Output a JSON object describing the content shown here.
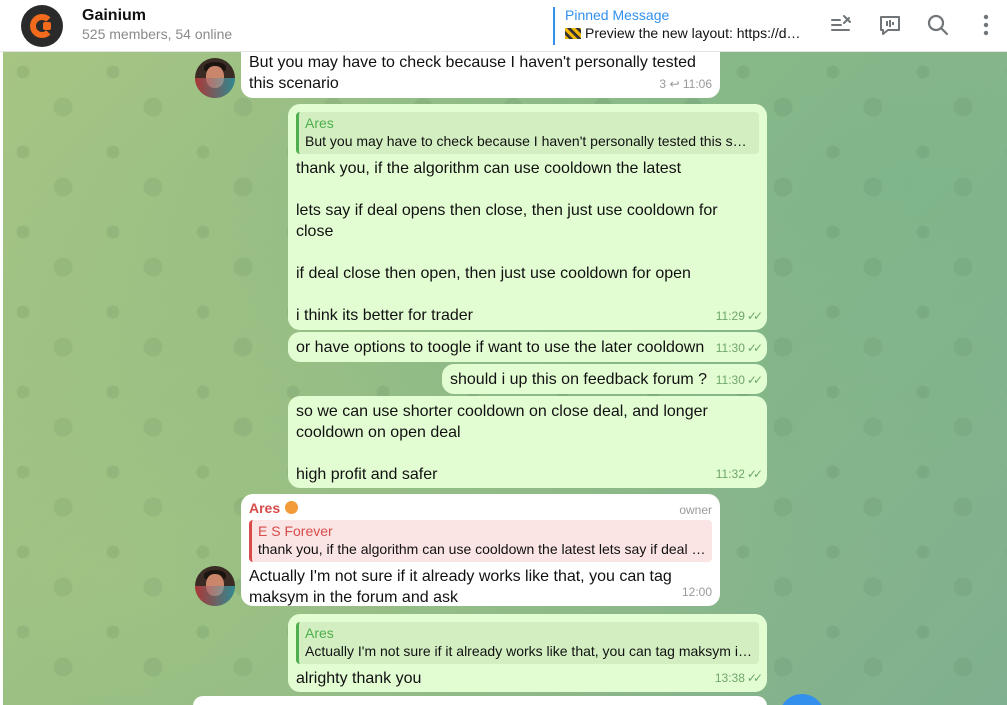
{
  "header": {
    "title": "Gainium",
    "subtitle": "525 members, 54 online",
    "pinned": {
      "label": "Pinned Message",
      "text": "Preview the new layout: https://d…"
    },
    "icons": [
      "pinned-list-icon",
      "live-stream-icon",
      "search-icon",
      "more-vertical-icon"
    ]
  },
  "messages": [
    {
      "text": "But you may have to check because I haven't personally tested this scenario",
      "replies": "3",
      "time": "11:06"
    },
    {
      "quote_name": "Ares",
      "quote_text": "But you may have to check because I haven't personally tested this sce…",
      "text": "thank you, if the algorithm can use cooldown the latest\n\nlets say if deal opens then close, then just use cooldown for close\n\nif deal close then open, then just use cooldown for open\n\ni think its better for trader",
      "time": "11:29"
    },
    {
      "text": "or have options to toogle if want to use the later cooldown",
      "time": "11:30"
    },
    {
      "text": "should i up this on feedback forum ?",
      "time": "11:30"
    },
    {
      "text": "so we can use shorter cooldown on close deal, and longer cooldown on open deal\n\nhigh profit and safer",
      "time": "11:32"
    },
    {
      "sender": "Ares",
      "role": "owner",
      "quote_name": "E S Forever",
      "quote_text": "thank you, if the algorithm can use cooldown the latest lets say if deal …",
      "text": "Actually I'm not sure if it already works like that, you can tag maksym in the forum and ask",
      "time": "12:00"
    },
    {
      "quote_name": "Ares",
      "quote_text": "Actually I'm not sure if it already works like that, you can tag maksym in…",
      "text": "alrighty thank you",
      "time": "13:38"
    }
  ],
  "colors": {
    "accent": "#3390ec",
    "outgoing_bubble": "#e3fdd3",
    "incoming_bubble": "#ffffff",
    "reply_green": "#4fae4e",
    "reply_red": "#d84b4b",
    "logo_orange": "#f26b1d"
  }
}
